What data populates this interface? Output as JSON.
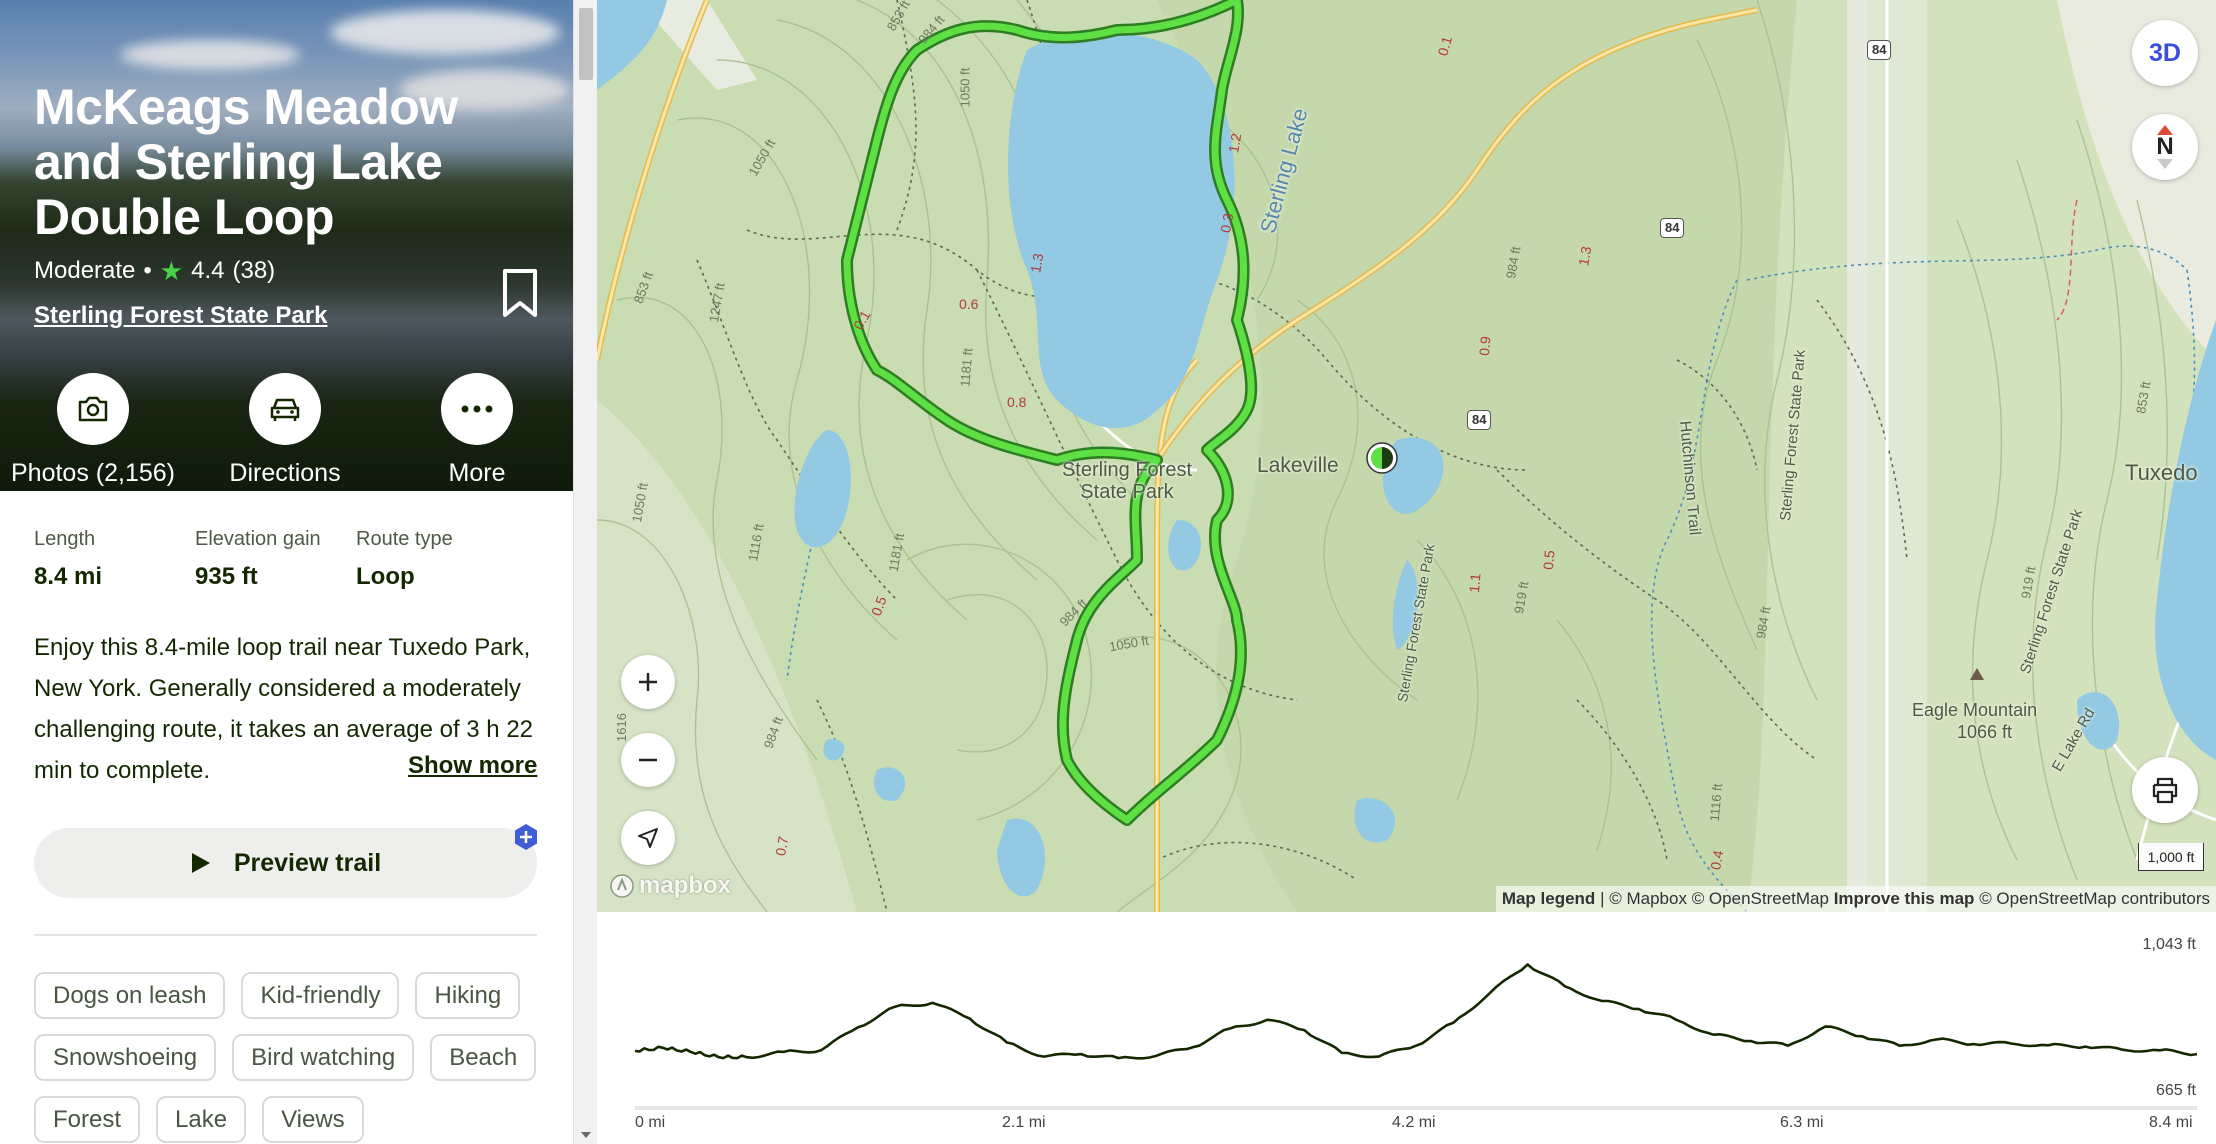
{
  "trail": {
    "title": "McKeags Meadow and Sterling Lake Double Loop",
    "difficulty": "Moderate",
    "separator": "•",
    "rating": "4.4",
    "reviews": "(38)",
    "park": "Sterling Forest State Park"
  },
  "actions": {
    "photos": "Photos (2,156)",
    "directions": "Directions",
    "more": "More"
  },
  "stats": [
    {
      "label": "Length",
      "value": "8.4 mi"
    },
    {
      "label": "Elevation gain",
      "value": "935 ft"
    },
    {
      "label": "Route type",
      "value": "Loop"
    }
  ],
  "description": "Enjoy this 8.4-mile loop trail near Tuxedo Park, New York. Generally considered a moderately challenging route, it takes an average of 3 h 22 min to complete.",
  "show_more": "Show more",
  "preview_button": "Preview trail",
  "tags": [
    "Dogs on leash",
    "Kid-friendly",
    "Hiking",
    "Snowshoeing",
    "Bird watching",
    "Beach",
    "Forest",
    "Lake",
    "Views"
  ],
  "map": {
    "btn_3d": "3D",
    "north": "N",
    "scale": "1,000 ft",
    "attribution": {
      "legend": "Map legend",
      "sep": "|",
      "mapbox": "© Mapbox",
      "osm": "© OpenStreetMap",
      "improve": "Improve this map",
      "contrib": "© OpenStreetMap contributors"
    },
    "logo": "mapbox",
    "labels": {
      "lake": "Sterling Lake",
      "park": "Sterling Forest State Park",
      "lakeville": "Lakeville",
      "tuxedo": "Tuxedo",
      "eagle": "Eagle Mountain",
      "eagle_elev": "1066 ft",
      "hutchinson": "Hutchinson Trail",
      "park_road": "Sterling Forest State Park",
      "park_road2": "Sterling Forest State Park",
      "east_lake": "E Lake Rd",
      "hwy": "84"
    },
    "elevation_labels": [
      "853 ft",
      "984 ft",
      "1050 ft",
      "1050 ft",
      "1247 ft",
      "853 ft",
      "1116 ft",
      "1050 ft",
      "1181 ft",
      "1181 ft",
      "984 ft",
      "1050 ft",
      "984 ft",
      "919 ft",
      "984 ft",
      "1116 ft",
      "1616",
      "984 ft",
      "919 ft",
      "853 ft"
    ],
    "segment_labels": [
      "0.1",
      "0.6",
      "1.3",
      "0.8",
      "0.5",
      "0.7",
      "0.3",
      "1.2",
      "0.1",
      "0.9",
      "1.3",
      "0.5",
      "1.1",
      "0.4"
    ]
  },
  "chart_data": {
    "type": "area",
    "xlabel": "",
    "ylabel": "",
    "x_ticks": [
      "0 mi",
      "2.1 mi",
      "4.2 mi",
      "6.3 mi",
      "8.4 mi"
    ],
    "ylim": [
      665,
      1043
    ],
    "y_labels": [
      "1,043 ft",
      "665 ft"
    ],
    "x": [
      0,
      0.15,
      0.3,
      0.45,
      0.6,
      0.8,
      1.0,
      1.2,
      1.4,
      1.6,
      1.8,
      2.0,
      2.2,
      2.4,
      2.6,
      2.8,
      3.0,
      3.2,
      3.4,
      3.6,
      3.8,
      4.0,
      4.2,
      4.4,
      4.6,
      4.8,
      5.0,
      5.2,
      5.4,
      5.6,
      5.8,
      6.0,
      6.2,
      6.4,
      6.6,
      6.8,
      7.0,
      7.2,
      7.4,
      7.6,
      7.8,
      8.0,
      8.2,
      8.4
    ],
    "y": [
      758,
      768,
      755,
      738,
      738,
      755,
      760,
      834,
      900,
      912,
      862,
      785,
      740,
      748,
      735,
      742,
      770,
      830,
      858,
      825,
      752,
      740,
      775,
      848,
      945,
      1035,
      965,
      918,
      892,
      858,
      810,
      790,
      775,
      836,
      805,
      775,
      795,
      780,
      782,
      776,
      772,
      762,
      760,
      748
    ]
  }
}
